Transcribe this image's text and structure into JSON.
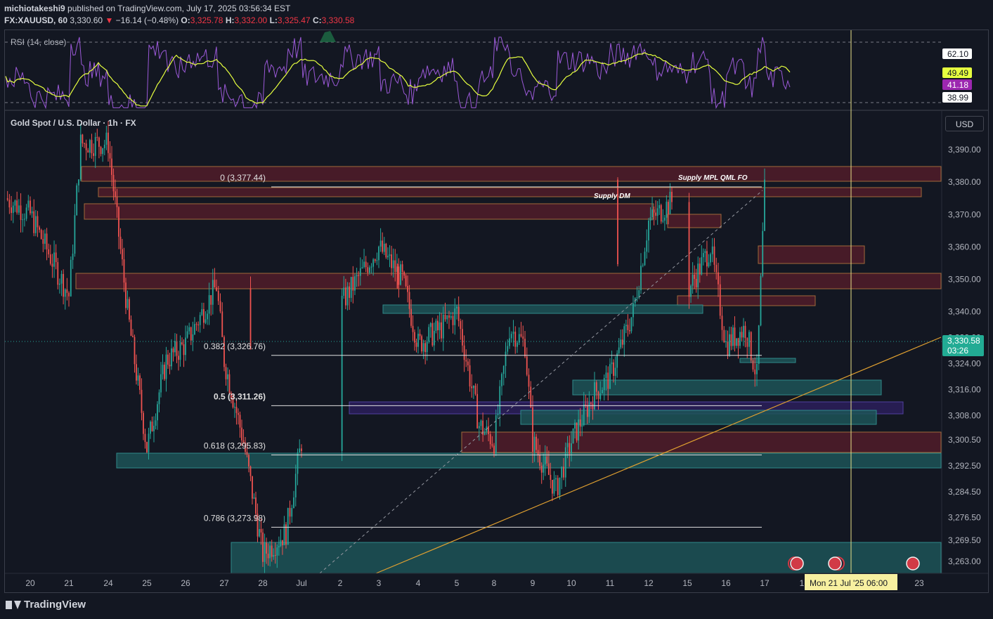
{
  "header": {
    "author": "michiotakeshi9",
    "published_text": "published on TradingView.com, July 17, 2025 03:56:34 EST",
    "symbol": "FX:XAUUSD, 60",
    "last": "3,330.60",
    "change_arrow": "▼",
    "change": "−16.14 (−0.48%)",
    "o_label": "O:",
    "o": "3,325.78",
    "h_label": "H:",
    "h": "3,332.00",
    "l_label": "L:",
    "l": "3,325.47",
    "c_label": "C:",
    "c": "3,330.58"
  },
  "rsi": {
    "legend": "RSI (14, close)",
    "badges": [
      "62.10",
      "49.49",
      "41.18",
      "38.99"
    ],
    "badge_colors": [
      "#ffffff",
      "#e6ff3f",
      "#9c27b0",
      "#ffffff"
    ]
  },
  "main": {
    "legend": "Gold Spot / U.S. Dollar · 1h · FX",
    "currency_button": "USD",
    "price_badge": "3,330.58",
    "countdown": "03:26",
    "crosshair_date": "Mon 21 Jul '25   06:00"
  },
  "footer": {
    "brand": "TradingView"
  },
  "colors": {
    "bull": "#26a69a",
    "bear": "#ef5350",
    "supply": "#6b2230",
    "demand": "#1e5a5e",
    "rsi_line": "#9b59d8",
    "rsi_ma": "#e6ff3f",
    "trendline": "#e0a030",
    "crosshair": "#e8e089"
  },
  "chart_data": {
    "type": "candlestick",
    "title": "Gold Spot / U.S. Dollar · 1h · FX",
    "y_axis": {
      "unit": "USD",
      "ticks": [
        "3,390.00",
        "3,380.00",
        "3,370.00",
        "3,360.00",
        "3,350.00",
        "3,340.00",
        "3,332.00",
        "3,324.00",
        "3,316.00",
        "3,308.00",
        "3,300.50",
        "3,292.50",
        "3,284.50",
        "3,276.50",
        "3,269.50",
        "3,263.00"
      ]
    },
    "x_axis": {
      "ticks": [
        "20",
        "21",
        "24",
        "25",
        "26",
        "27",
        "28",
        "Jul",
        "2",
        "3",
        "4",
        "5",
        "8",
        "9",
        "10",
        "11",
        "12",
        "15",
        "16",
        "17",
        "1",
        "23"
      ]
    },
    "last_price": 3330.58,
    "fibonacci": [
      {
        "label": "0 (3,377.44)",
        "level": 3377.44
      },
      {
        "label": "0.382 (3,326.76)",
        "level": 3326.76
      },
      {
        "label": "0.5 (3,311.26)",
        "level": 3311.26
      },
      {
        "label": "0.618 (3,295.83)",
        "level": 3295.83
      },
      {
        "label": "0.786 (3,273.98)",
        "level": 3273.98
      }
    ],
    "zone_labels": [
      "Supply MPL QML FO",
      "Supply DM"
    ],
    "price_path": [
      {
        "t": "20",
        "p": 3370
      },
      {
        "t": "21",
        "p": 3345
      },
      {
        "t": "21.3",
        "p": 3392
      },
      {
        "t": "24",
        "p": 3392
      },
      {
        "t": "24.5",
        "p": 3340
      },
      {
        "t": "25",
        "p": 3298
      },
      {
        "t": "25.5",
        "p": 3325
      },
      {
        "t": "26",
        "p": 3330
      },
      {
        "t": "26.8",
        "p": 3348
      },
      {
        "t": "27",
        "p": 3325
      },
      {
        "t": "27.5",
        "p": 3300
      },
      {
        "t": "28",
        "p": 3265
      },
      {
        "t": "28.6",
        "p": 3272
      },
      {
        "t": "Jul",
        "p": 3300
      },
      {
        "t": "1.7",
        "p": 3345
      },
      {
        "t": "2",
        "p": 3342
      },
      {
        "t": "3",
        "p": 3360
      },
      {
        "t": "3.6",
        "p": 3350
      },
      {
        "t": "4",
        "p": 3330
      },
      {
        "t": "4.6",
        "p": 3335
      },
      {
        "t": "5",
        "p": 3340
      },
      {
        "t": "5.6",
        "p": 3305
      },
      {
        "t": "8",
        "p": 3300
      },
      {
        "t": "8.4",
        "p": 3335
      },
      {
        "t": "8.8",
        "p": 3330
      },
      {
        "t": "9",
        "p": 3300
      },
      {
        "t": "9.6",
        "p": 3285
      },
      {
        "t": "10",
        "p": 3300
      },
      {
        "t": "10.6",
        "p": 3315
      },
      {
        "t": "11",
        "p": 3320
      },
      {
        "t": "11.6",
        "p": 3340
      },
      {
        "t": "12",
        "p": 3368
      },
      {
        "t": "12.6",
        "p": 3374
      },
      {
        "t": "13.5",
        "p": 3345
      },
      {
        "t": "15",
        "p": 3346
      },
      {
        "t": "15.6",
        "p": 3360
      },
      {
        "t": "16",
        "p": 3330
      },
      {
        "t": "16.5",
        "p": 3335
      },
      {
        "t": "16.8",
        "p": 3320
      },
      {
        "t": "17",
        "p": 3377
      },
      {
        "t": "17.2",
        "p": 3352
      },
      {
        "t": "17.5",
        "p": 3345
      },
      {
        "t": "17.7",
        "p": 3330.58
      }
    ]
  }
}
